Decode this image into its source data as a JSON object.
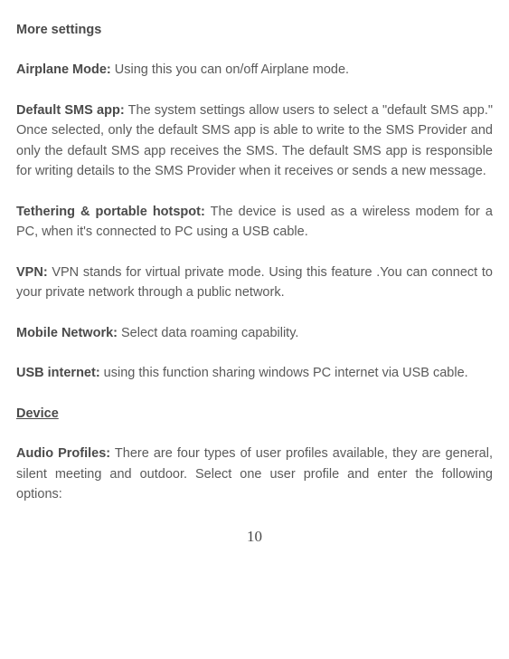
{
  "title": "More settings",
  "airplane": {
    "label": "Airplane Mode:",
    "text": " Using this you can on/off Airplane mode."
  },
  "sms": {
    "label": "Default SMS app:",
    "text": " The system settings allow users to select a \"default SMS app.\" Once selected, only the default SMS app is able to write to the SMS Provider and only the default SMS app receives the SMS. The default SMS app is responsible for writing details to the SMS Provider when it receives or sends a new message."
  },
  "tethering": {
    "label": "Tethering & portable hotspot:",
    "text": " The device is used as a wireless modem for a PC, when it's connected to PC using a USB cable."
  },
  "vpn": {
    "label": "VPN:",
    "text": " VPN stands for virtual private mode. Using this feature .You can connect to your private network through a public network."
  },
  "mobile": {
    "label": "Mobile Network:",
    "text": " Select data roaming capability."
  },
  "usb": {
    "label": "USB internet:",
    "text": " using this function sharing windows PC internet via USB cable."
  },
  "device_heading": "Device",
  "audio": {
    "label": "Audio Profiles:",
    "text": " There are four types of user profiles available, they are general, silent meeting and outdoor. Select one user profile and enter the following options:"
  },
  "page_number": "10"
}
